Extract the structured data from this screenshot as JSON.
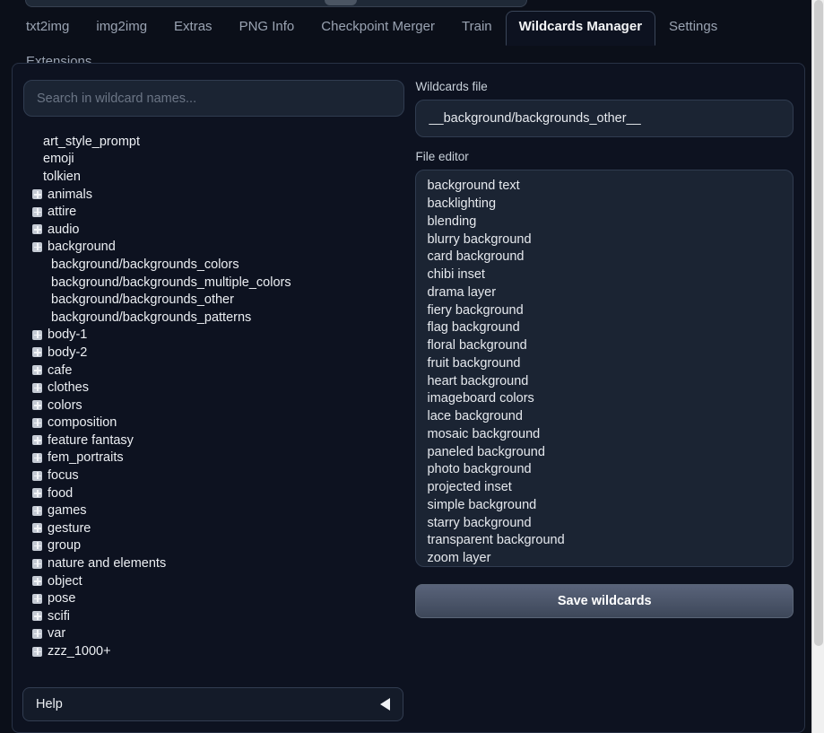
{
  "tabs": [
    {
      "label": "txt2img",
      "active": false
    },
    {
      "label": "img2img",
      "active": false
    },
    {
      "label": "Extras",
      "active": false
    },
    {
      "label": "PNG Info",
      "active": false
    },
    {
      "label": "Checkpoint Merger",
      "active": false
    },
    {
      "label": "Train",
      "active": false
    },
    {
      "label": "Wildcards Manager",
      "active": true
    },
    {
      "label": "Settings",
      "active": false
    },
    {
      "label": "Extensions",
      "active": false
    }
  ],
  "search": {
    "placeholder": "Search in wildcard names...",
    "value": ""
  },
  "tree": [
    {
      "label": "art_style_prompt",
      "depth": 0,
      "toggle": false
    },
    {
      "label": "emoji",
      "depth": 0,
      "toggle": false
    },
    {
      "label": "tolkien",
      "depth": 0,
      "toggle": false
    },
    {
      "label": "animals",
      "depth": 0,
      "toggle": true
    },
    {
      "label": "attire",
      "depth": 0,
      "toggle": true
    },
    {
      "label": "audio",
      "depth": 0,
      "toggle": true
    },
    {
      "label": "background",
      "depth": 0,
      "toggle": true
    },
    {
      "label": "background/backgrounds_colors",
      "depth": 1,
      "toggle": false
    },
    {
      "label": "background/backgrounds_multiple_colors",
      "depth": 1,
      "toggle": false
    },
    {
      "label": "background/backgrounds_other",
      "depth": 1,
      "toggle": false
    },
    {
      "label": "background/backgrounds_patterns",
      "depth": 1,
      "toggle": false
    },
    {
      "label": "body-1",
      "depth": 0,
      "toggle": true
    },
    {
      "label": "body-2",
      "depth": 0,
      "toggle": true
    },
    {
      "label": "cafe",
      "depth": 0,
      "toggle": true
    },
    {
      "label": "clothes",
      "depth": 0,
      "toggle": true
    },
    {
      "label": "colors",
      "depth": 0,
      "toggle": true
    },
    {
      "label": "composition",
      "depth": 0,
      "toggle": true
    },
    {
      "label": "feature fantasy",
      "depth": 0,
      "toggle": true
    },
    {
      "label": "fem_portraits",
      "depth": 0,
      "toggle": true
    },
    {
      "label": "focus",
      "depth": 0,
      "toggle": true
    },
    {
      "label": "food",
      "depth": 0,
      "toggle": true
    },
    {
      "label": "games",
      "depth": 0,
      "toggle": true
    },
    {
      "label": "gesture",
      "depth": 0,
      "toggle": true
    },
    {
      "label": "group",
      "depth": 0,
      "toggle": true
    },
    {
      "label": "nature and elements",
      "depth": 0,
      "toggle": true
    },
    {
      "label": "object",
      "depth": 0,
      "toggle": true
    },
    {
      "label": "pose",
      "depth": 0,
      "toggle": true
    },
    {
      "label": "scifi",
      "depth": 0,
      "toggle": true
    },
    {
      "label": "var",
      "depth": 0,
      "toggle": true
    },
    {
      "label": "zzz_1000+",
      "depth": 0,
      "toggle": true
    }
  ],
  "help": {
    "label": "Help",
    "arrow_icon": "triangle-left-icon",
    "expanded": false
  },
  "wildcards_file": {
    "label": "Wildcards file",
    "value": "__background/backgrounds_other__"
  },
  "file_editor": {
    "label": "File editor",
    "lines": [
      "background text",
      "backlighting",
      "blending",
      "blurry background",
      "card background",
      "chibi inset",
      "drama layer",
      "fiery background",
      "flag background",
      "floral background",
      "fruit background",
      "heart background",
      "imageboard colors",
      "lace background",
      "mosaic background",
      "paneled background",
      "photo background",
      "projected inset",
      "simple background",
      "starry background",
      "transparent background",
      "zoom layer"
    ]
  },
  "save_button": {
    "label": "Save wildcards"
  },
  "colors": {
    "page_background": "#0b0f19",
    "panel_background": "#0d1220",
    "input_background": "#1b2433",
    "border": "#303c50",
    "text_primary": "#eceff3",
    "text_muted": "#9aa3b2",
    "button_gradient_top": "#59637a",
    "button_gradient_bottom": "#3d4759",
    "toggle_icon": "#c4cad4",
    "scrollbar_track": "#f0f0f0"
  }
}
